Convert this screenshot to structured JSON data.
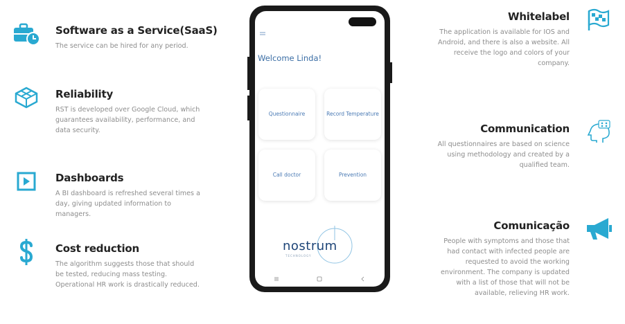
{
  "colors": {
    "accent": "#29a9d1",
    "title": "#222222",
    "body_text": "#8d8d8d",
    "app_blue": "#3b6ea5",
    "phone_body": "#1a1a1a"
  },
  "left_features": [
    {
      "icon": "briefcase-clock-icon",
      "title": "Software as a Service(SaaS)",
      "text": "The service can be hired for any period."
    },
    {
      "icon": "cube-icon",
      "title": "Reliability",
      "text": "RST is developed over Google Cloud, which guarantees availability, performance, and data security."
    },
    {
      "icon": "play-square-icon",
      "title": "Dashboards",
      "text": "A BI dashboard is refreshed several times a day, giving updated information to managers."
    },
    {
      "icon": "dollar-icon",
      "title": "Cost reduction",
      "text": "The algorithm suggests those that should be tested, reducing mass testing. Operational HR work is drastically reduced."
    }
  ],
  "right_features": [
    {
      "icon": "checkered-flag-icon",
      "title": "Whitelabel",
      "text": "The application is available for IOS and Android, and there is also a website. All receive the logo and colors of your company."
    },
    {
      "icon": "head-chat-icon",
      "title": "Communication",
      "text": "All questionnaires are based on science using methodology and created by a qualified team."
    },
    {
      "icon": "megaphone-icon",
      "title": "Comunicação",
      "text": "People with symptoms and those that had contact with infected people are requested to avoid the working environment. The company is updated with a list of those that will not be available, relieving HR work."
    }
  ],
  "phone": {
    "welcome": "Welcome Linda!",
    "tiles": [
      "Questionnaire",
      "Record Temperature",
      "Call doctor",
      "Prevention"
    ],
    "logo_text": "nostrum",
    "logo_tagline": "TECHNOLOGY"
  }
}
